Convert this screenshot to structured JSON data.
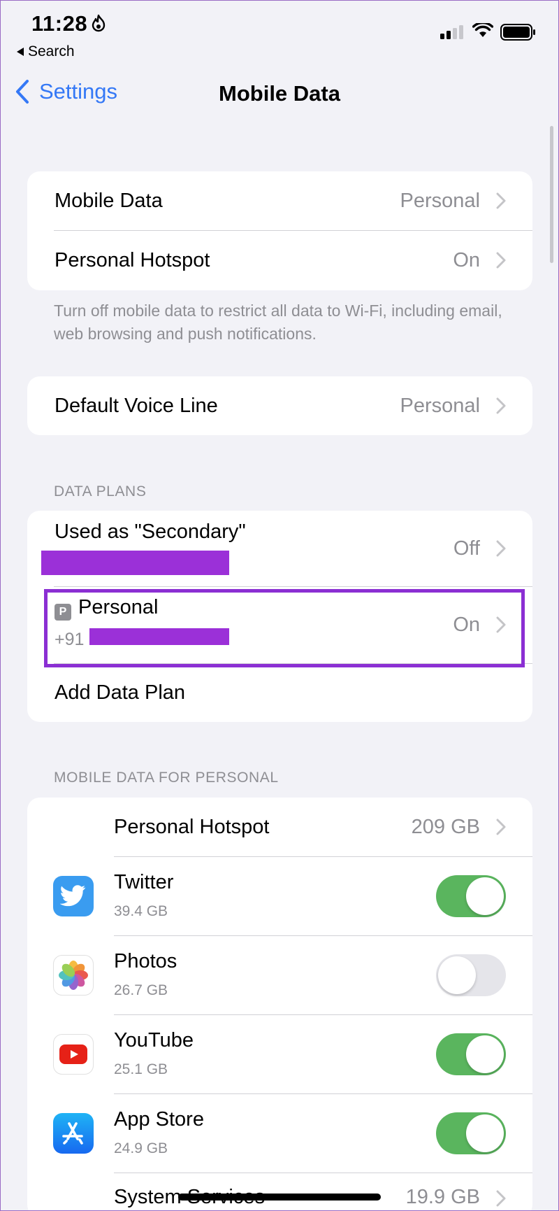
{
  "status_bar": {
    "time": "11:28",
    "back_app_label": "Search"
  },
  "nav": {
    "back_label": "Settings",
    "title": "Mobile Data"
  },
  "group1": {
    "rows": [
      {
        "label": "Mobile Data",
        "value": "Personal"
      },
      {
        "label": "Personal Hotspot",
        "value": "On"
      }
    ],
    "footnote": "Turn off mobile data to restrict all data to Wi-Fi, including email, web browsing and push notifications."
  },
  "group2": {
    "rows": [
      {
        "label": "Default Voice Line",
        "value": "Personal"
      }
    ]
  },
  "data_plans": {
    "header": "DATA PLANS",
    "secondary": {
      "label": "Used as \"Secondary\"",
      "value": "Off"
    },
    "personal": {
      "badge": "P",
      "label": "Personal",
      "number_prefix": "+91",
      "value": "On"
    },
    "add_plan": "Add Data Plan"
  },
  "mobile_data_for": {
    "header": "MOBILE DATA FOR PERSONAL",
    "hotspot": {
      "label": "Personal Hotspot",
      "value": "209 GB"
    },
    "apps": [
      {
        "name": "Twitter",
        "size": "39.4 GB",
        "enabled": true,
        "icon": "twitter-icon"
      },
      {
        "name": "Photos",
        "size": "26.7 GB",
        "enabled": false,
        "icon": "photos-icon"
      },
      {
        "name": "YouTube",
        "size": "25.1 GB",
        "enabled": true,
        "icon": "youtube-icon"
      },
      {
        "name": "App Store",
        "size": "24.9 GB",
        "enabled": true,
        "icon": "app-store-icon"
      }
    ],
    "system_services": {
      "label": "System Services",
      "value": "19.9 GB"
    }
  },
  "colors": {
    "accent": "#3478f6",
    "toggle_on": "#5ab55e",
    "redaction": "#9b30d8"
  }
}
